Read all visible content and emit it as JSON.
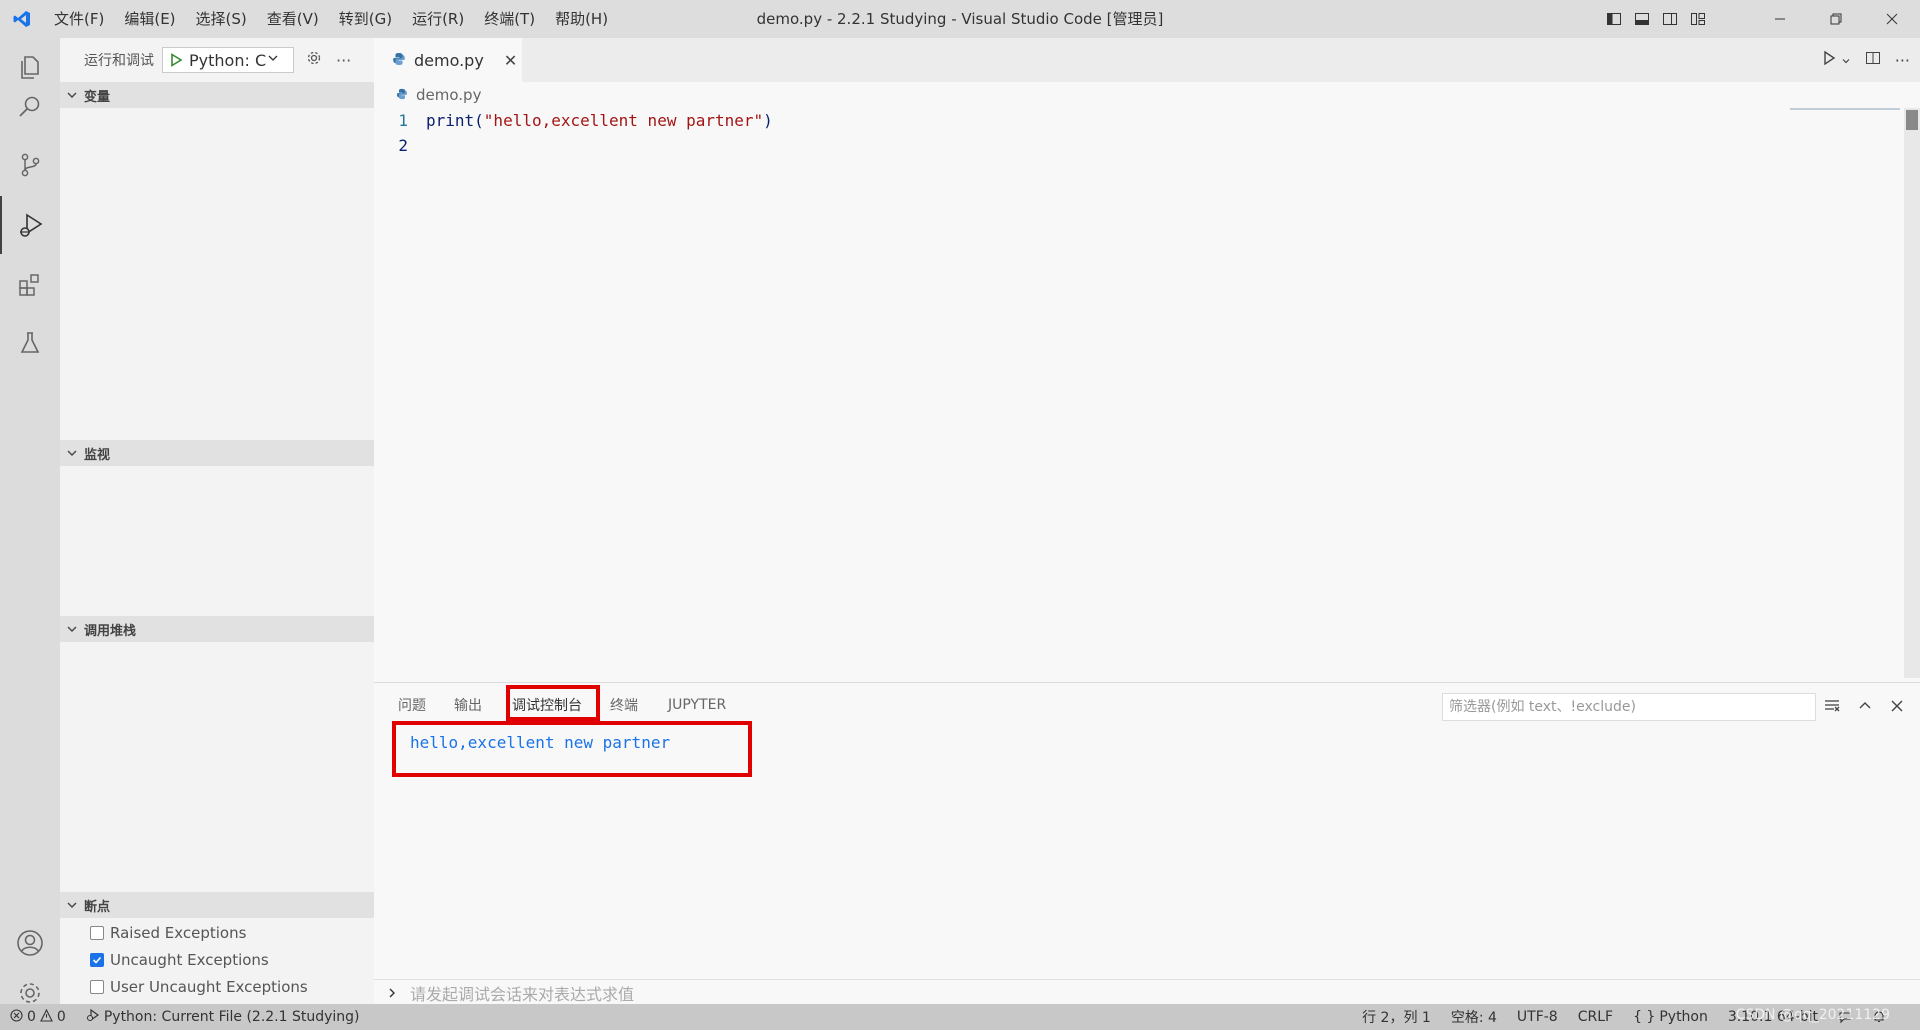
{
  "window": {
    "title": "demo.py - 2.2.1 Studying - Visual Studio Code [管理员]",
    "menu": [
      "文件(F)",
      "编辑(E)",
      "选择(S)",
      "查看(V)",
      "转到(G)",
      "运行(R)",
      "终端(T)",
      "帮助(H)"
    ]
  },
  "sidebar": {
    "header": "运行和调试",
    "config": "Python: Cu",
    "sections": {
      "variables": "变量",
      "watch": "监视",
      "callstack": "调用堆栈",
      "breakpoints": "断点"
    },
    "breakpoints": [
      {
        "label": "Raised Exceptions",
        "checked": false
      },
      {
        "label": "Uncaught Exceptions",
        "checked": true
      },
      {
        "label": "User Uncaught Exceptions",
        "checked": false
      }
    ]
  },
  "editor": {
    "tab": "demo.py",
    "breadcrumb": "demo.py",
    "lines": [
      {
        "num": "1",
        "fn": "print(",
        "str": "\"hello,excellent new partner\"",
        "close": ")"
      },
      {
        "num": "2",
        "fn": "",
        "str": "",
        "close": ""
      }
    ]
  },
  "panel": {
    "tabs": [
      "问题",
      "输出",
      "调试控制台",
      "终端",
      "JUPYTER"
    ],
    "active_tab": "调试控制台",
    "filter_placeholder": "筛选器(例如 text、!exclude)",
    "output": "hello,excellent new partner",
    "repl_placeholder": "请发起调试会话来对表达式求值"
  },
  "statusbar": {
    "errors": "0",
    "warnings": "0",
    "debug_config": "Python: Current File (2.2.1 Studying)",
    "position": "行 2，列 1",
    "spaces": "空格: 4",
    "encoding": "UTF-8",
    "eol": "CRLF",
    "language": "Python",
    "interpreter": "3.10.1 64-bit",
    "watermark": "CSDN @qq_20211129"
  },
  "colors": {
    "accent": "#1a73e8",
    "highlight_box": "#e00000",
    "string": "#a31515"
  }
}
